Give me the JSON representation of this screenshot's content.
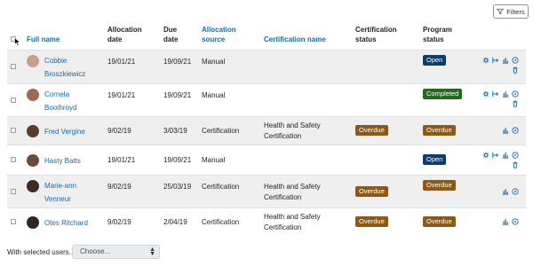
{
  "toolbar": {
    "filters_label": "Filters",
    "filter_icon": "funnel-icon"
  },
  "table": {
    "headers": {
      "full_name": "Full name",
      "allocation_date": "Allocation date",
      "due_date": "Due date",
      "allocation_source": "Allocation source",
      "certification_name": "Certification name",
      "certification_status": "Certification status",
      "program_status": "Program status"
    },
    "rows": [
      {
        "name": "Cobbie Broszkiewicz",
        "allocation_date": "19/01/21",
        "due_date": "19/09/21",
        "source": "Manual",
        "certification": "",
        "cert_status": "",
        "program_status": "Open"
      },
      {
        "name": "Cornela Boothroyd",
        "allocation_date": "19/01/21",
        "due_date": "19/09/21",
        "source": "Manual",
        "certification": "",
        "cert_status": "",
        "program_status": "Completed"
      },
      {
        "name": "Fred Vergine",
        "allocation_date": "9/02/19",
        "due_date": "3/03/19",
        "source": "Certification",
        "certification": "Health and Safety Certification",
        "cert_status": "Overdue",
        "program_status": "Overdue"
      },
      {
        "name": "Hasty Batts",
        "allocation_date": "19/01/21",
        "due_date": "19/09/21",
        "source": "Manual",
        "certification": "",
        "cert_status": "",
        "program_status": "Open"
      },
      {
        "name": "Marie-ann Venneur",
        "allocation_date": "9/02/19",
        "due_date": "25/03/19",
        "source": "Certification",
        "certification": "Health and Safety Certification",
        "cert_status": "Overdue",
        "program_status": "Overdue"
      },
      {
        "name": "Otes Ritchard",
        "allocation_date": "9/02/19",
        "due_date": "2/04/19",
        "source": "Certification",
        "certification": "Health and Safety Certification",
        "cert_status": "Overdue",
        "program_status": "Overdue"
      }
    ]
  },
  "colors": {
    "link": "#0f6cbf",
    "overdue": "#8a5a18",
    "open": "#0b3e6f",
    "completed": "#226b1f",
    "stripe": "#efefef"
  },
  "bulk": {
    "label": "With selected users...",
    "select_value": "Choose..."
  }
}
